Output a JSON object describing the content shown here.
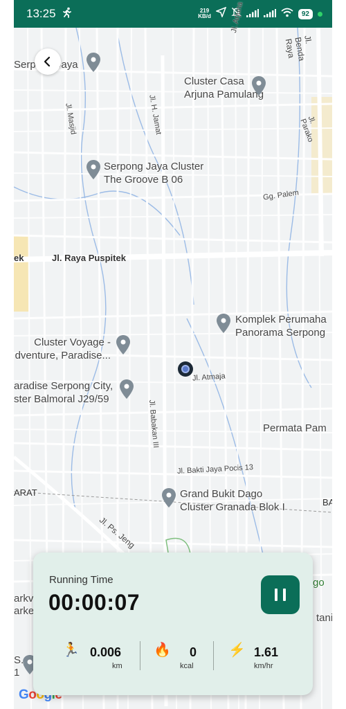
{
  "status_bar": {
    "time": "13:25",
    "activity_icon": "running-person-icon",
    "net_speed_value": "219",
    "net_speed_unit": "KB/d",
    "battery": "92",
    "icons": [
      "navigation-arrow-icon",
      "bell-off-icon",
      "signal-icon",
      "signal-icon",
      "wifi-icon",
      "battery-icon"
    ]
  },
  "map": {
    "back_icon": "chevron-left-icon",
    "places": [
      {
        "line1": "Serpong Jaya",
        "line2": ""
      },
      {
        "line1": "Cluster Casa",
        "line2": "Arjuna Pamulang"
      },
      {
        "line1": "Serpong Jaya Cluster",
        "line2": "The Groove B 06"
      },
      {
        "line1": "Komplek Perumaha",
        "line2": "Panorama Serpong"
      },
      {
        "line1": "Cluster Voyage -",
        "line2": "dventure, Paradise..."
      },
      {
        "line1": "aradise Serpong City,",
        "line2": "ster Balmoral J29/59"
      },
      {
        "line1": "Permata Pam",
        "line2": ""
      },
      {
        "line1": "Grand Bukit Dago",
        "line2": "Cluster Granada Blok I"
      }
    ],
    "streets": {
      "masjid": "Jl. Masjid",
      "jamat": "Jl. H. Jamat",
      "arjuna": "Jl. Arjuna",
      "benda_raya": "Jl. Benda Raya",
      "parako": "Jl. Parako",
      "palem": "Gg. Palem",
      "raya_puspitek": "Jl. Raya Puspitek",
      "puspitek_left": "ek",
      "atmaja": "Jl. Atmaja",
      "babakan": "Jl. Babakan III",
      "bakti_jaya": "Jl. Bakti Jaya Pocis 13",
      "arat": "ARAT",
      "ps_jengkol": "Jl. Ps. Jeng",
      "ba": "BA",
      "go": "go",
      "arkv": "arkv",
      "arke": "arke",
      "tani": "tani",
      "s": "S.",
      "one": "1",
      "google": "Google"
    }
  },
  "panel": {
    "title": "Running Time",
    "time": "00:00:07",
    "pause_icon": "pause-icon",
    "stats": [
      {
        "icon": "🏃",
        "icon_name": "runner-icon",
        "value": "0.006",
        "unit": "km"
      },
      {
        "icon": "🔥",
        "icon_name": "fire-icon",
        "value": "0",
        "unit": "kcal"
      },
      {
        "icon": "⚡",
        "icon_name": "lightning-icon",
        "value": "1.61",
        "unit": "km/hr"
      }
    ]
  },
  "colors": {
    "primary": "#0b6e58",
    "panel_bg": "#e1efea",
    "map_bg": "#f1f3f4"
  }
}
